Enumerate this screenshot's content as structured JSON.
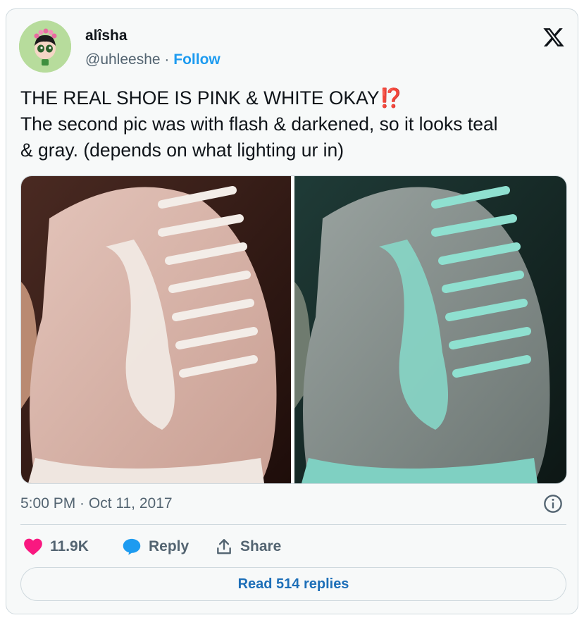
{
  "author": {
    "display_name": "alîsha",
    "handle": "@uhleeshe",
    "separator": "·",
    "follow_label": "Follow"
  },
  "tweet": {
    "line1": "THE REAL SHOE IS PINK & WHITE OKAY",
    "line1_emoji": "⁉️",
    "line2": "The second pic was with flash & darkened, so it looks teal",
    "line3": "& gray. (depends on what lighting ur in)"
  },
  "media": {
    "left_photo": "shoe-pink-white",
    "right_photo": "shoe-teal-gray"
  },
  "meta": {
    "timestamp": "5:00 PM · Oct 11, 2017"
  },
  "actions": {
    "like_count": "11.9K",
    "reply_label": "Reply",
    "share_label": "Share"
  },
  "replies": {
    "label": "Read 514 replies"
  },
  "colors": {
    "accent": "#1d9bf0",
    "like": "#f91880",
    "muted": "#536471"
  }
}
